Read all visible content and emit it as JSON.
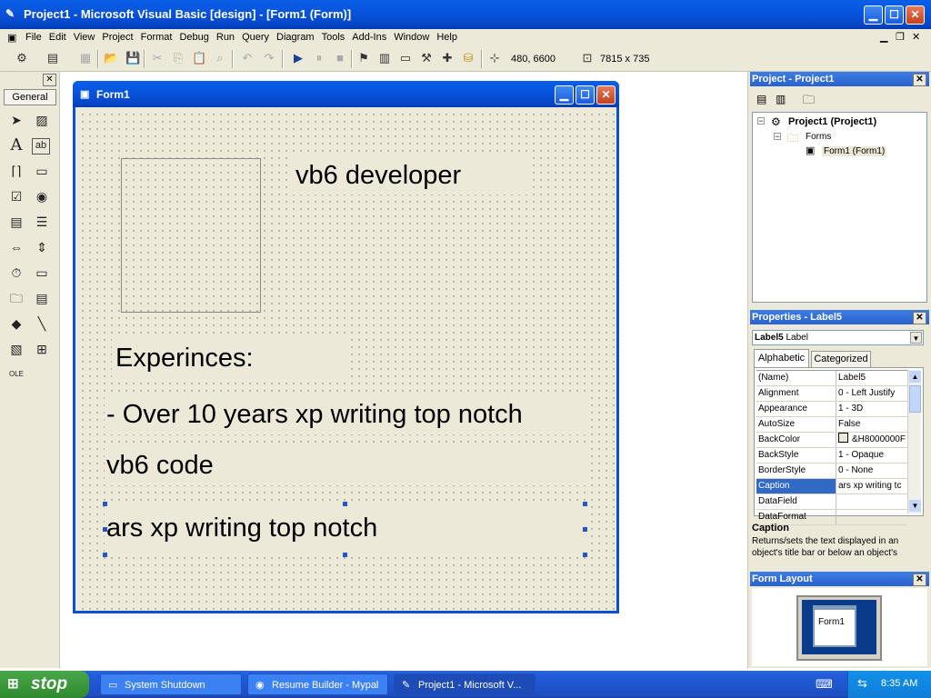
{
  "window": {
    "title": "Project1 - Microsoft Visual Basic [design] - [Form1 (Form)]",
    "app_icon": "vb-icon",
    "controls": {
      "minimize": "▁",
      "maximize": "☐",
      "close": "✕"
    }
  },
  "menubar": {
    "items": [
      "File",
      "Edit",
      "View",
      "Project",
      "Format",
      "Debug",
      "Run",
      "Query",
      "Diagram",
      "Tools",
      "Add-Ins",
      "Window",
      "Help"
    ]
  },
  "toolbar": {
    "position": "480, 6600",
    "size": "7815 x 735"
  },
  "toolbox": {
    "title": "General",
    "tools": [
      "pointer-icon",
      "picturebox-icon",
      "label-icon",
      "textbox-icon",
      "frame-icon",
      "commandbutton-icon",
      "checkbox-icon",
      "optionbutton-icon",
      "combobox-icon",
      "listbox-icon",
      "hscrollbar-icon",
      "vscrollbar-icon",
      "timer-icon",
      "drivelistbox-icon",
      "dirlistbox-icon",
      "filelistbox-icon",
      "shape-icon",
      "line-icon",
      "image-icon",
      "data-icon",
      "ole-icon"
    ]
  },
  "form": {
    "title": "Form1",
    "labels": {
      "name": "vb6 developer",
      "heading": "Experinces:",
      "line1": "- Over 10 years xp writing top notch",
      "line2": "vb6 code",
      "selected": "ars xp writing top notch"
    }
  },
  "project_panel": {
    "title": "Project - Project1",
    "tree": {
      "project": "Project1 (Project1)",
      "folder": "Forms",
      "form": "Form1 (Form1)"
    }
  },
  "properties_panel": {
    "title": "Properties - Label5",
    "object_name": "Label5",
    "object_type": "Label",
    "tabs": [
      "Alphabetic",
      "Categorized"
    ],
    "rows": [
      {
        "name": "(Name)",
        "value": "Label5"
      },
      {
        "name": "Alignment",
        "value": "0 - Left Justify"
      },
      {
        "name": "Appearance",
        "value": "1 - 3D"
      },
      {
        "name": "AutoSize",
        "value": "False"
      },
      {
        "name": "BackColor",
        "value": "&H8000000F"
      },
      {
        "name": "BackStyle",
        "value": "1 - Opaque"
      },
      {
        "name": "BorderStyle",
        "value": "0 - None"
      },
      {
        "name": "Caption",
        "value": "ars xp writing tc"
      },
      {
        "name": "DataField",
        "value": ""
      },
      {
        "name": "DataFormat",
        "value": ""
      }
    ],
    "description_title": "Caption",
    "description_text": "Returns/sets the text displayed in an object's title bar or below an object's"
  },
  "form_layout_panel": {
    "title": "Form Layout",
    "preview_label": "Form1"
  },
  "taskbar": {
    "start": "stop",
    "tasks": [
      {
        "label": "System Shutdown"
      },
      {
        "label": "Resume Builder - Mypal"
      },
      {
        "label": "Project1 - Microsoft V..."
      }
    ],
    "clock": "8:35 AM"
  },
  "colors": {
    "title_blue": "#0855dd",
    "panel_bg": "#ece9d8",
    "selection": "#316ac5",
    "taskbar_blue": "#245edb",
    "start_green": "#3c9a3c"
  }
}
